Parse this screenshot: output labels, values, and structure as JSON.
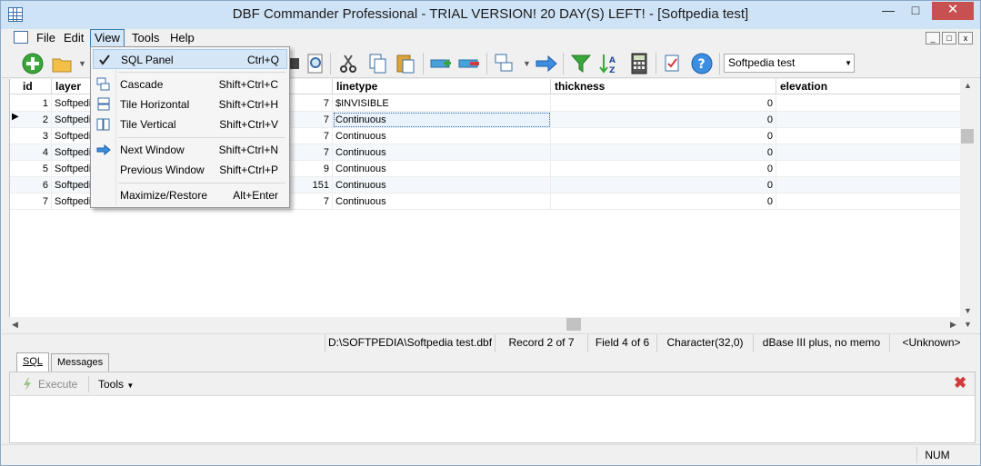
{
  "window": {
    "title": "DBF Commander Professional - TRIAL VERSION! 20 DAY(S) LEFT! - [Softpedia test]"
  },
  "menu": {
    "file": "File",
    "edit": "Edit",
    "view": "View",
    "tools": "Tools",
    "help": "Help"
  },
  "toolbar": {
    "combo_value": "Softpedia test"
  },
  "grid": {
    "columns": {
      "id": "id",
      "layer": "layer",
      "linetype": "linetype",
      "thickness": "thickness",
      "elevation": "elevation"
    },
    "rows": [
      {
        "id": "1",
        "layer": "Softpedi",
        "color": "7",
        "linetype": "$INVISIBLE",
        "thickness": "0"
      },
      {
        "id": "2",
        "layer": "Softpedi",
        "color": "7",
        "linetype": "Continuous",
        "thickness": "0"
      },
      {
        "id": "3",
        "layer": "Softpedi",
        "color": "7",
        "linetype": "Continuous",
        "thickness": "0"
      },
      {
        "id": "4",
        "layer": "Softpedi",
        "color": "7",
        "linetype": "Continuous",
        "thickness": "0"
      },
      {
        "id": "5",
        "layer": "Softpedi",
        "color": "9",
        "linetype": "Continuous",
        "thickness": "0"
      },
      {
        "id": "6",
        "layer": "Softpedi",
        "color": "151",
        "linetype": "Continuous",
        "thickness": "0"
      },
      {
        "id": "7",
        "layer": "Softpedi",
        "color": "7",
        "linetype": "Continuous",
        "thickness": "0"
      }
    ]
  },
  "status": {
    "path": "D:\\SOFTPEDIA\\Softpedia test.dbf",
    "record": "Record 2 of 7",
    "field": "Field 4 of 6",
    "type": "Character(32,0)",
    "format": "dBase III plus, no memo",
    "codepage": "<Unknown>"
  },
  "sql": {
    "tab_sql": "SQL",
    "tab_messages": "Messages",
    "execute": "Execute",
    "tools": "Tools"
  },
  "bottom": {
    "num": "NUM"
  },
  "view_menu": {
    "items": [
      {
        "label": "SQL Panel",
        "shortcut": "Ctrl+Q"
      },
      {
        "label": "Cascade",
        "shortcut": "Shift+Ctrl+C"
      },
      {
        "label": "Tile Horizontal",
        "shortcut": "Shift+Ctrl+H"
      },
      {
        "label": "Tile Vertical",
        "shortcut": "Shift+Ctrl+V"
      },
      {
        "label": "Next Window",
        "shortcut": "Shift+Ctrl+N"
      },
      {
        "label": "Previous Window",
        "shortcut": "Shift+Ctrl+P"
      },
      {
        "label": "Maximize/Restore",
        "shortcut": "Alt+Enter"
      }
    ]
  }
}
